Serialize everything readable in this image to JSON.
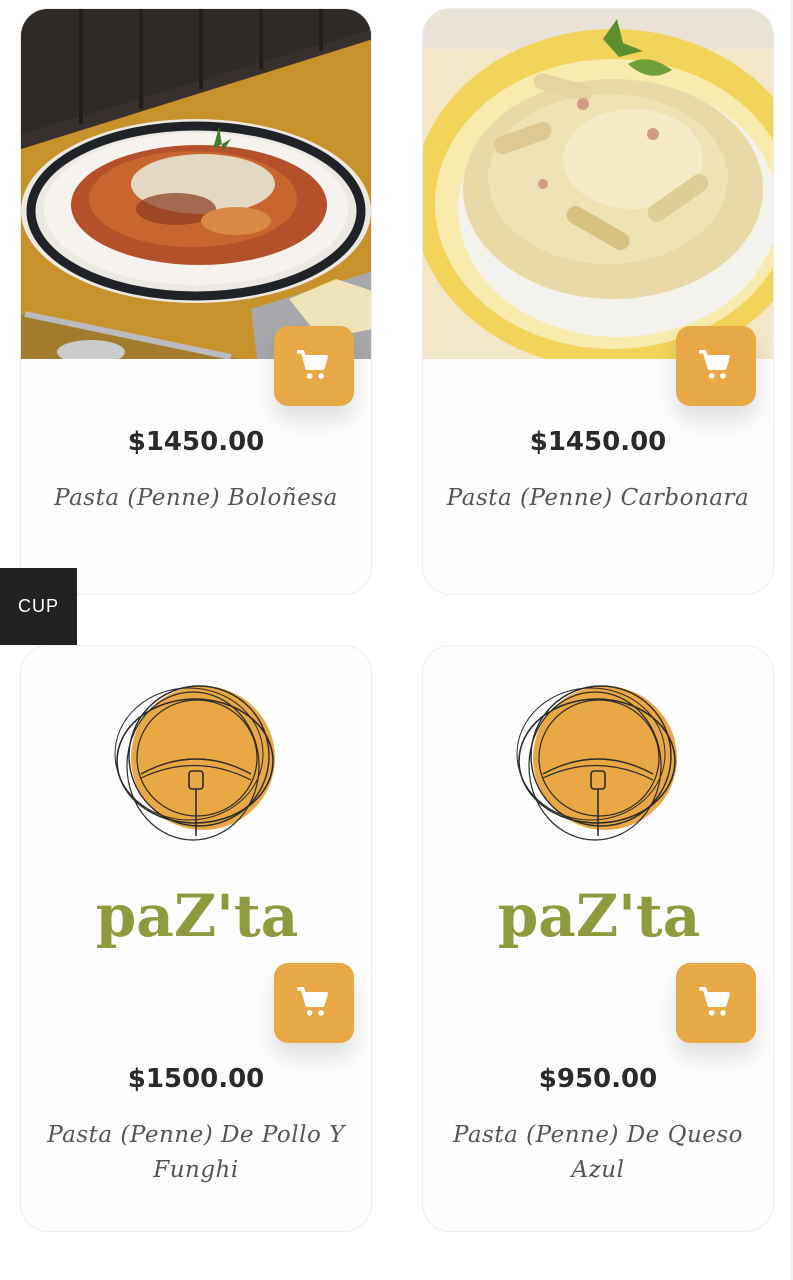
{
  "side_tab": {
    "label": "CUP"
  },
  "products": [
    {
      "price": "$1450.00",
      "name": "Pasta (Penne) Boloñesa",
      "image": "bolognese-plate-photo",
      "cart_icon": "cart-icon"
    },
    {
      "price": "$1450.00",
      "name": "Pasta (Penne) Carbonara",
      "image": "carbonara-plate-photo",
      "cart_icon": "cart-icon"
    },
    {
      "price": "$1500.00",
      "name": "Pasta (Penne) De Pollo Y Funghi",
      "image": "pazta-logo",
      "cart_icon": "cart-icon"
    },
    {
      "price": "$950.00",
      "name": "Pasta (Penne) De Queso Azul",
      "image": "pazta-logo",
      "cart_icon": "cart-icon"
    }
  ],
  "logo": {
    "wordmark": "paZ'ta"
  },
  "colors": {
    "accent": "#e8a845",
    "logo_green": "#8f9a3c",
    "price_text": "#2a2a2a",
    "name_text": "#555555",
    "side_tab_bg": "#222222"
  }
}
